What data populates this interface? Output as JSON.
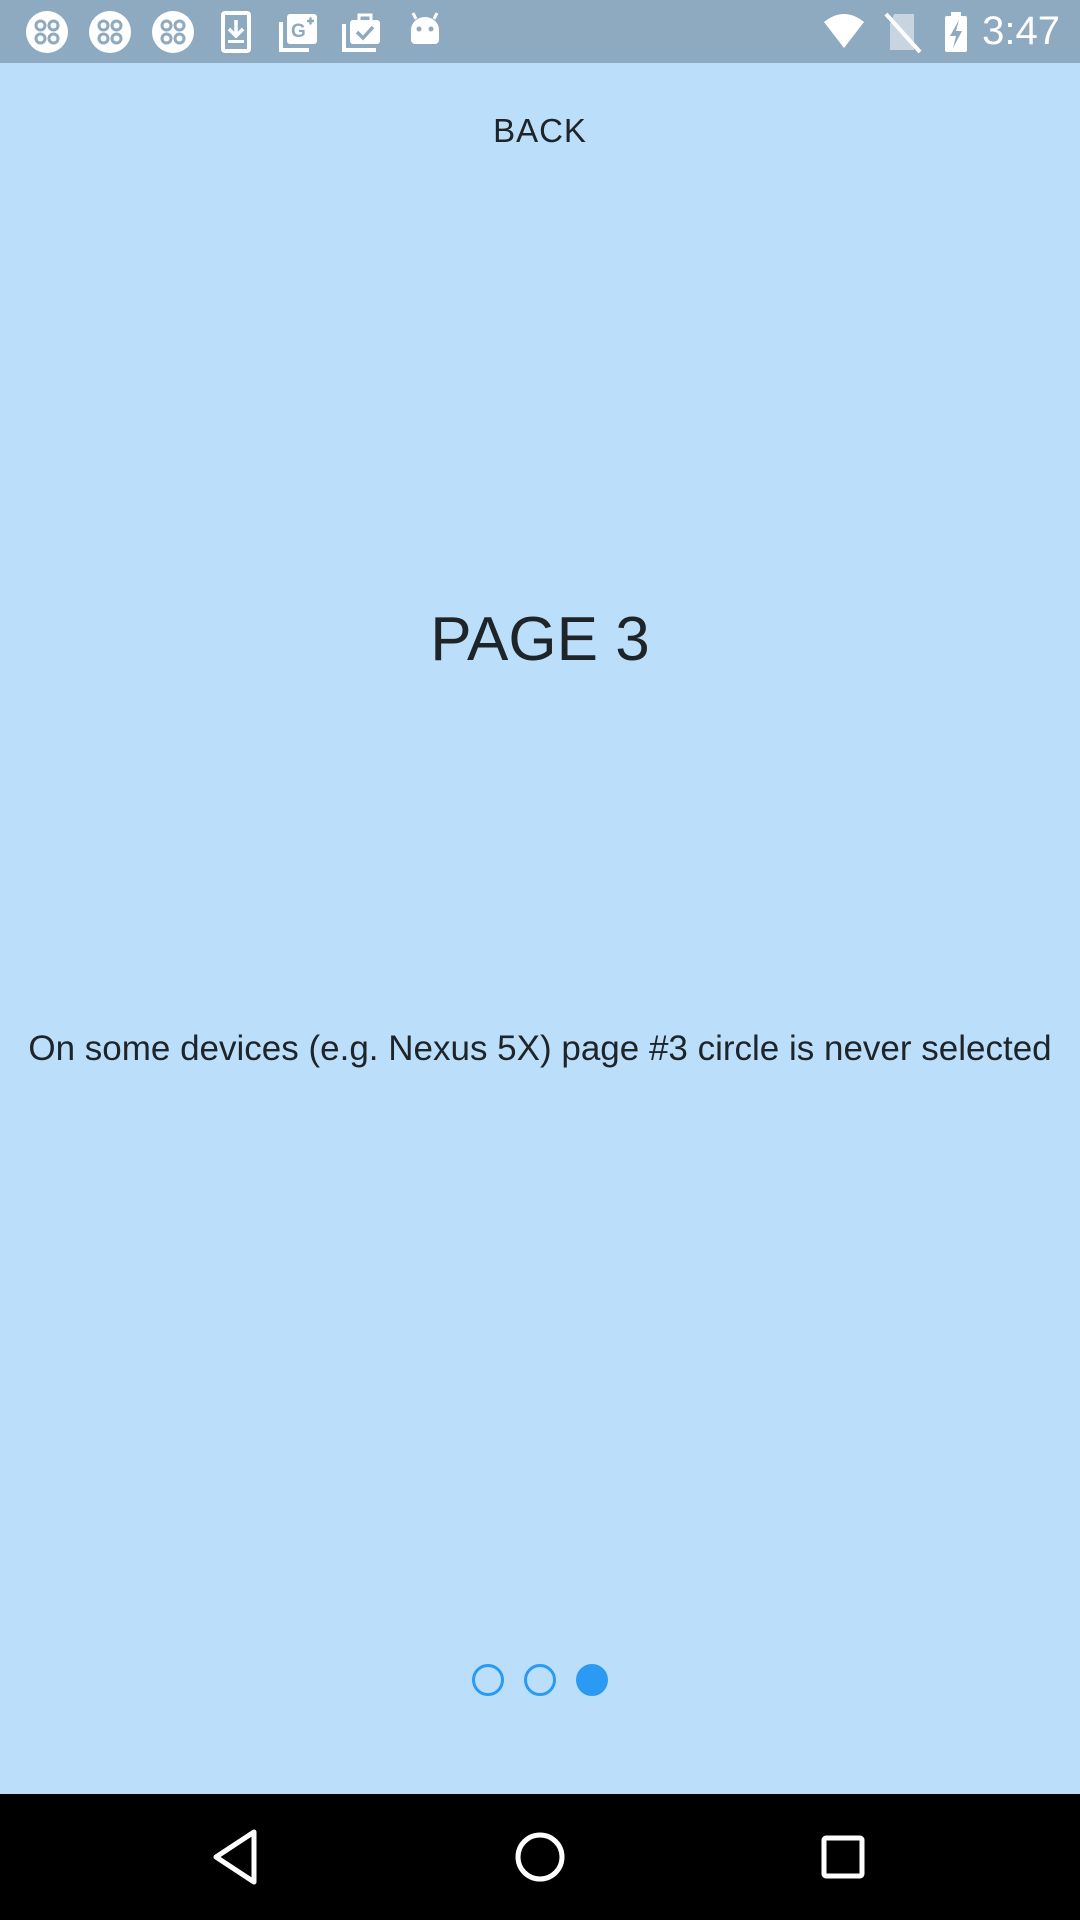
{
  "status_bar": {
    "time": "3:47",
    "notification_icons": [
      "pinwheel-icon",
      "pinwheel-icon",
      "pinwheel-icon",
      "download-icon",
      "google-plus-photo-icon",
      "briefcase-check-icon",
      "android-icon"
    ],
    "system_icons": [
      "wifi-icon",
      "no-sim-icon",
      "battery-charging-icon"
    ],
    "background_color": "#8eaac1"
  },
  "toolbar": {
    "back_label": "BACK"
  },
  "page": {
    "title": "PAGE 3",
    "note": "On some devices (e.g. Nexus 5X) page #3 circle is never selected",
    "background_color": "#bbdefa"
  },
  "pager_indicator": {
    "page_count": 3,
    "selected_index": 2,
    "accent_color": "#2b9af3"
  },
  "nav_bar": {
    "buttons": [
      "back-triangle-icon",
      "home-circle-icon",
      "recents-square-icon"
    ]
  }
}
